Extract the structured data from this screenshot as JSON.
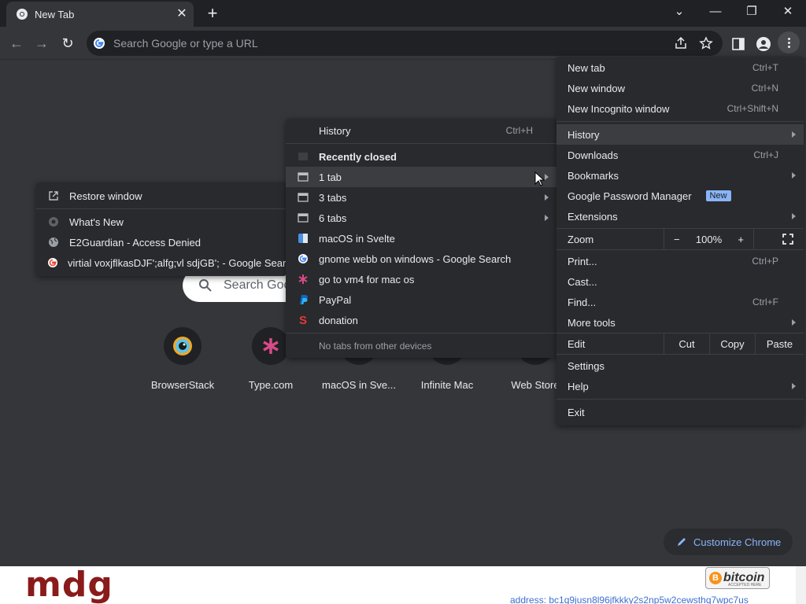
{
  "tab": {
    "title": "New Tab",
    "close": "✕",
    "new_tab": "+"
  },
  "window": {
    "chevron": "⌄",
    "minimize": "—",
    "restore": "❐",
    "close": "✕"
  },
  "toolbar": {
    "back": "←",
    "forward": "→",
    "reload": "↻",
    "omnibox_placeholder": "Search Google or type a URL"
  },
  "ntp": {
    "search_placeholder": "Search Google or type a URL",
    "shortcuts": [
      "BrowserStack",
      "Type.com",
      "macOS in Sve...",
      "Infinite Mac",
      "Web Store"
    ],
    "customize": "Customize Chrome"
  },
  "main_menu": {
    "items_top": [
      {
        "label": "New tab",
        "shortcut": "Ctrl+T"
      },
      {
        "label": "New window",
        "shortcut": "Ctrl+N"
      },
      {
        "label": "New Incognito window",
        "shortcut": "Ctrl+Shift+N"
      }
    ],
    "items_mid": [
      {
        "label": "History",
        "shortcut": ""
      },
      {
        "label": "Downloads",
        "shortcut": "Ctrl+J"
      },
      {
        "label": "Bookmarks",
        "shortcut": ""
      },
      {
        "label": "Google Password Manager",
        "shortcut": ""
      },
      {
        "label": "Extensions",
        "shortcut": ""
      }
    ],
    "password_badge": "New",
    "zoom": {
      "label": "Zoom",
      "minus": "−",
      "value": "100%",
      "plus": "+"
    },
    "items_tools": [
      {
        "label": "Print...",
        "shortcut": "Ctrl+P"
      },
      {
        "label": "Cast...",
        "shortcut": ""
      },
      {
        "label": "Find...",
        "shortcut": "Ctrl+F"
      },
      {
        "label": "More tools",
        "shortcut": ""
      }
    ],
    "edit": {
      "label": "Edit",
      "cut": "Cut",
      "copy": "Copy",
      "paste": "Paste"
    },
    "items_bottom": [
      {
        "label": "Settings"
      },
      {
        "label": "Help"
      }
    ],
    "exit": "Exit"
  },
  "history_menu": {
    "history": {
      "label": "History",
      "shortcut": "Ctrl+H"
    },
    "recently_closed": "Recently closed",
    "groups": [
      "1 tab",
      "3 tabs",
      "6 tabs"
    ],
    "entries": [
      "macOS in Svelte",
      "gnome webb on windows - Google Search",
      "go to vm4 for mac os",
      "PayPal",
      "donation"
    ],
    "no_devices": "No tabs from other devices"
  },
  "window_menu": {
    "restore": "Restore window",
    "items": [
      "What's New",
      "E2Guardian - Access Denied",
      "virtial voxjflkasDJF';alfg;vl sdjGB'; - Google Search"
    ]
  },
  "banner": {
    "logo": "mdg",
    "btc_word": "bitcoin",
    "btc_symbol": "B",
    "btc_sub": "ACCEPTED HERE",
    "address": "address: bc1q9jusn8l96jfkkky2s2np5w2cewsthq7wpc7us"
  },
  "colors": {
    "accent": "#8ab4f8",
    "menu_bg": "#292a2d",
    "page_bg": "#35363a",
    "logo": "#8b1a1a"
  }
}
